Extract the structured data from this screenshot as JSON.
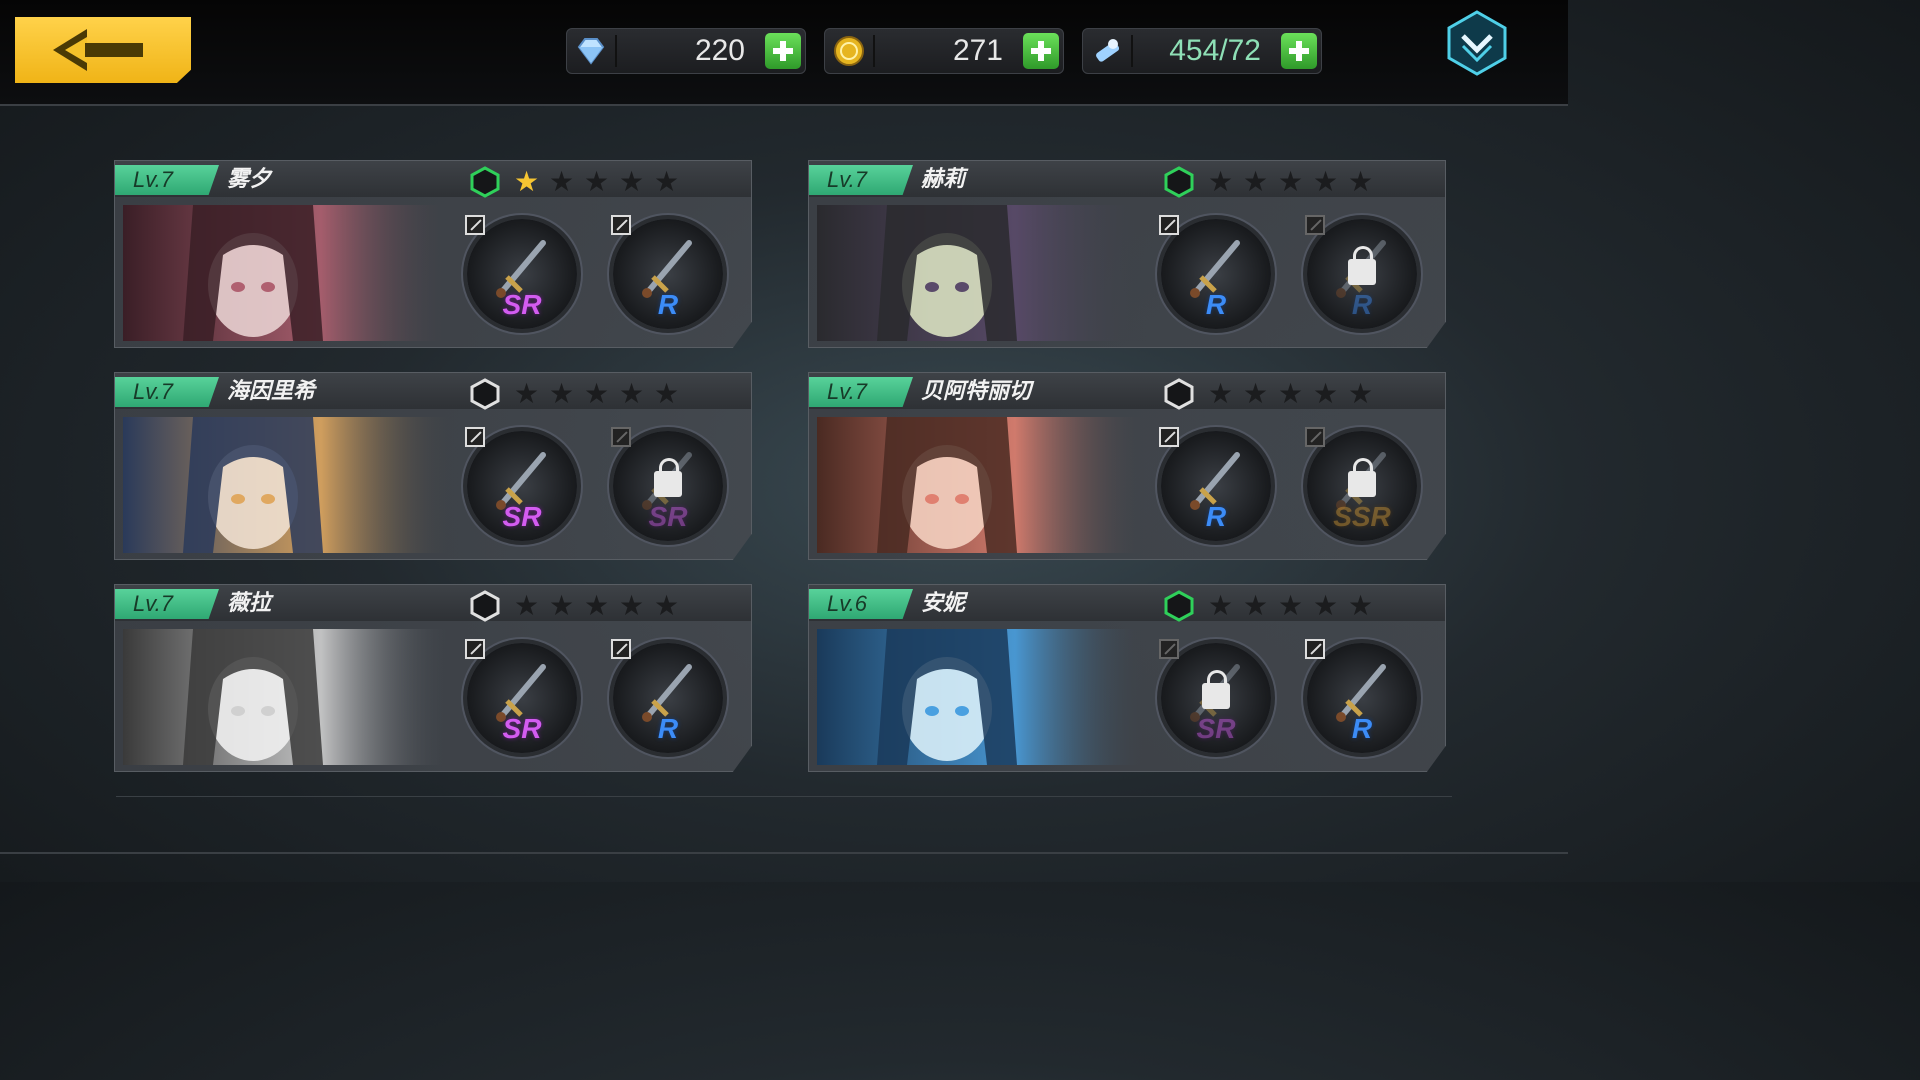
{
  "topbar": {
    "resources": [
      {
        "icon": "diamond-icon",
        "value": "220"
      },
      {
        "icon": "gold-coin-icon",
        "value": "271"
      },
      {
        "icon": "stamina-ticket-icon",
        "value": "454/72"
      }
    ]
  },
  "colors": {
    "accent_gold": "#f5c22a",
    "level_green": "#3fbf85",
    "star_on": "#f6c532",
    "hex_active": "#2fd05a",
    "rarity_sr": "#d35cf0",
    "rarity_r": "#3c8cf7",
    "rarity_ssr": "#d69a32"
  },
  "cards": [
    {
      "level": "Lv.7",
      "name": "雾夕",
      "hex_active": true,
      "stars": 1,
      "slots": [
        {
          "rarity": "SR",
          "locked": false,
          "weapon": "fan-weapon-icon"
        },
        {
          "rarity": "R",
          "locked": false,
          "weapon": "staff-weapon-icon"
        }
      ]
    },
    {
      "level": "Lv.7",
      "name": "赫莉",
      "hex_active": true,
      "stars": 0,
      "slots": [
        {
          "rarity": "R",
          "locked": false,
          "weapon": "rifle-weapon-icon"
        },
        {
          "rarity": "R",
          "locked": true,
          "weapon": "rifle-weapon-icon"
        }
      ]
    },
    {
      "level": "Lv.7",
      "name": "海因里希",
      "hex_active": false,
      "stars": 0,
      "slots": [
        {
          "rarity": "SR",
          "locked": false,
          "weapon": "twin-sword-weapon-icon"
        },
        {
          "rarity": "SR",
          "locked": true,
          "weapon": "blade-weapon-icon"
        }
      ]
    },
    {
      "level": "Lv.7",
      "name": "贝阿特丽切",
      "hex_active": false,
      "stars": 0,
      "slots": [
        {
          "rarity": "R",
          "locked": false,
          "weapon": "rapier-weapon-icon"
        },
        {
          "rarity": "SSR",
          "locked": true,
          "weapon": "greatsword-weapon-icon"
        }
      ]
    },
    {
      "level": "Lv.7",
      "name": "薇拉",
      "hex_active": false,
      "stars": 0,
      "slots": [
        {
          "rarity": "SR",
          "locked": false,
          "weapon": "cannon-weapon-icon"
        },
        {
          "rarity": "R",
          "locked": false,
          "weapon": "gun-weapon-icon"
        }
      ]
    },
    {
      "level": "Lv.6",
      "name": "安妮",
      "hex_active": true,
      "stars": 0,
      "slots": [
        {
          "rarity": "SR",
          "locked": true,
          "weapon": "camera-weapon-icon"
        },
        {
          "rarity": "R",
          "locked": false,
          "weapon": "wand-weapon-icon"
        }
      ]
    }
  ]
}
